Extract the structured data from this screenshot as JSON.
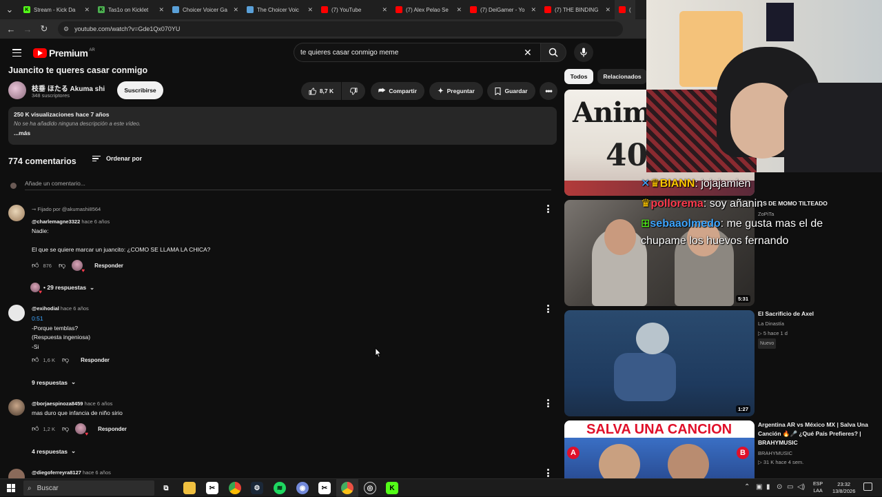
{
  "browser": {
    "tabs": [
      {
        "label": "Stream - Kick Da",
        "icon": "kick-icon",
        "color": "#53fc18"
      },
      {
        "label": "Tas1o on Kicklet",
        "icon": "kicklet-icon",
        "color": "#4caf50"
      },
      {
        "label": "Choicer Voicer Ga",
        "icon": "choicer-icon",
        "color": "#5aa0d8"
      },
      {
        "label": "The Choicer Voic",
        "icon": "choicer-icon",
        "color": "#5aa0d8"
      },
      {
        "label": "(7) YouTube",
        "icon": "youtube-icon",
        "color": "#ff0000"
      },
      {
        "label": "(7) Alex Pelao Se",
        "icon": "youtube-icon",
        "color": "#ff0000"
      },
      {
        "label": "(7) DeiGamer - Yo",
        "icon": "youtube-icon",
        "color": "#ff0000"
      },
      {
        "label": "(7) THE BINDING",
        "icon": "youtube-icon",
        "color": "#ff0000"
      },
      {
        "label": "(7",
        "icon": "youtube-icon",
        "color": "#ff0000"
      }
    ],
    "url": "youtube.com/watch?v=Gde1Qx070YU"
  },
  "header": {
    "logo_text": "Premium",
    "logo_region": "AR",
    "search_value": "te quieres casar conmigo meme"
  },
  "video": {
    "title": "Juancito te queres casar conmigo",
    "channel_name": "枝垂 ほたる Akuma shi",
    "channel_subs": "348 suscriptores",
    "subscribe_label": "Suscribirse",
    "likes": "8,7 K",
    "share_label": "Compartir",
    "ask_label": "Preguntar",
    "save_label": "Guardar",
    "description": {
      "stats": "250 K visualizaciones  hace 7 años",
      "text": "No se ha añadido ninguna descripción a este vídeo.",
      "more": "...más"
    }
  },
  "comments": {
    "count_label": "774 comentarios",
    "sort_label": "Ordenar por",
    "add_placeholder": "Añade un comentario...",
    "items": [
      {
        "pinned": "Fijado por @akumashi8564",
        "author": "@charlemagne3322",
        "time": "hace 6 años",
        "lines": [
          "Nadie:",
          "",
          "El que se quiere marcar un juancito: ¿COMO SE LLAMA LA CHICA?"
        ],
        "likes": "876",
        "reply_label": "Responder",
        "replies_label": "• 29 respuestas"
      },
      {
        "author": "@exihodial",
        "time": "hace 6 años",
        "timestamp_link": "0:51",
        "lines": [
          "-Porque temblas?",
          "(Respuesta ingeniosa)",
          "-Si"
        ],
        "likes": "1,6 K",
        "reply_label": "Responder",
        "replies_label": "9 respuestas"
      },
      {
        "author": "@borjaespinoza8459",
        "time": "hace 6 años",
        "lines": [
          "mas duro que infancia de niño sirio"
        ],
        "likes": "1,2 K",
        "reply_label": "Responder",
        "replies_label": "4 respuestas"
      },
      {
        "author": "@diegoferreyra8127",
        "time": "hace 6 años"
      }
    ]
  },
  "sidebar": {
    "chips": [
      "Todos",
      "Relacionados"
    ],
    "items": [
      {
        "thumb_text": "Anime",
        "thumb_sub": "40"
      },
      {
        "title": "...S DE MOMO TILTEADO",
        "channel": "ZoPiTa",
        "duration": "5:31"
      },
      {
        "title": "El Sacrificio de Axel",
        "channel": "La Dinastía",
        "meta": "▷ 5  hace 1 d",
        "badge": "Nuevo",
        "duration": "1:27"
      },
      {
        "title": "Argentina AR vs México MX | Salva Una Canción 🔥🎤 ¿Qué País Prefieres? | BRAHYMUSIC",
        "channel": "BRAHYMUSIC",
        "meta": "▷ 31 K  hace 4 sem.",
        "thumb_text": "SALVA UNA CANCION"
      }
    ]
  },
  "chat": [
    {
      "user": "BIANN",
      "message": "jojajamien"
    },
    {
      "user": "pollorema",
      "message": "soy añanin"
    },
    {
      "user": "sebaaolmedo",
      "message": "me gusta mas el de chupame los huevos fernando"
    }
  ],
  "taskbar": {
    "search_placeholder": "Buscar",
    "lang": "ESP",
    "lang_sub": "LAA",
    "time": "23:32",
    "date": "13/8/2026"
  },
  "colors": {
    "background": "#0f0f0f",
    "accent_red": "#ff0000",
    "link_blue": "#3ea6ff",
    "kick_green": "#53fc18"
  }
}
